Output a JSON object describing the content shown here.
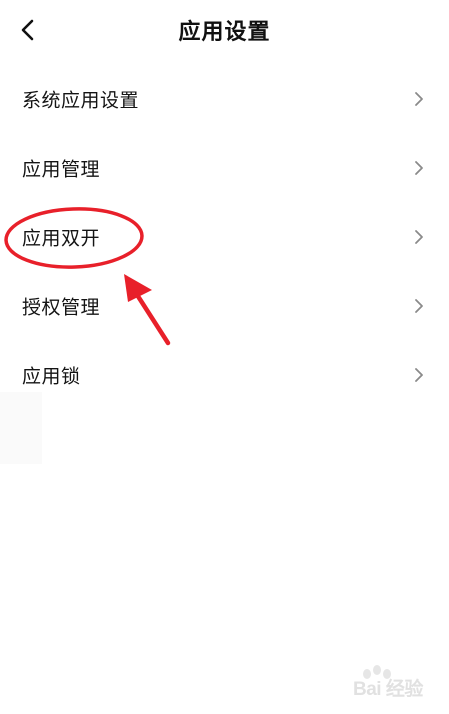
{
  "header": {
    "title": "应用设置",
    "back_icon": "chevron-left-icon"
  },
  "menu": {
    "items": [
      {
        "label": "系统应用设置",
        "icon": "chevron-right-icon"
      },
      {
        "label": "应用管理",
        "icon": "chevron-right-icon"
      },
      {
        "label": "应用双开",
        "icon": "chevron-right-icon",
        "highlighted": true
      },
      {
        "label": "授权管理",
        "icon": "chevron-right-icon"
      },
      {
        "label": "应用锁",
        "icon": "chevron-right-icon"
      }
    ]
  },
  "annotation": {
    "color": "#e8202a",
    "shape": "ellipse-with-arrow"
  },
  "watermark": {
    "text": "Bai 经验"
  }
}
